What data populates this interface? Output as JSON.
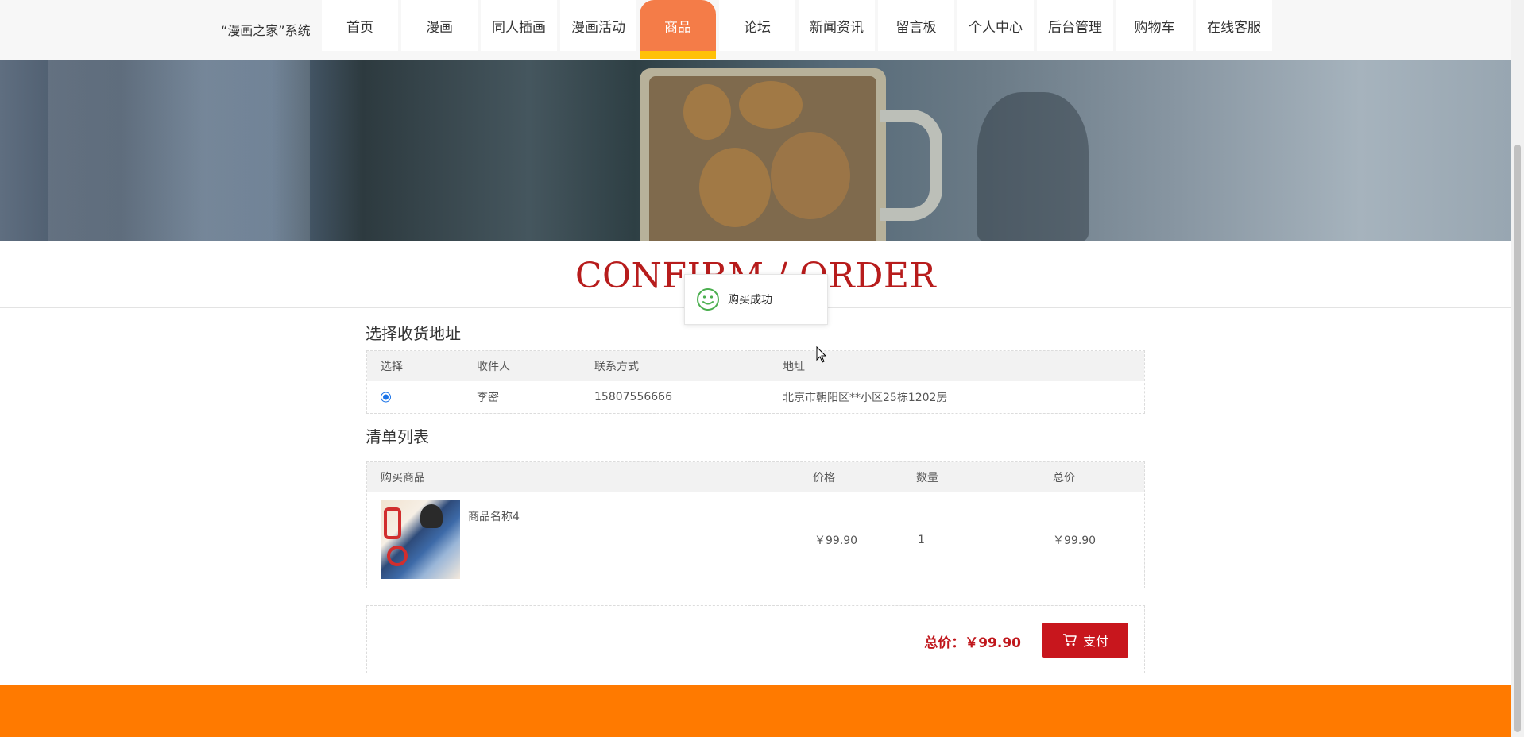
{
  "brand": "“漫画之家”系统",
  "nav": [
    {
      "label": "首页",
      "active": false
    },
    {
      "label": "漫画",
      "active": false
    },
    {
      "label": "同人插画",
      "active": false
    },
    {
      "label": "漫画活动",
      "active": false
    },
    {
      "label": "商品",
      "active": true
    },
    {
      "label": "论坛",
      "active": false
    },
    {
      "label": "新闻资讯",
      "active": false
    },
    {
      "label": "留言板",
      "active": false
    },
    {
      "label": "个人中心",
      "active": false
    },
    {
      "label": "后台管理",
      "active": false
    },
    {
      "label": "购物车",
      "active": false
    },
    {
      "label": "在线客服",
      "active": false
    }
  ],
  "page_title": "CONFIRM / ORDER",
  "toast": {
    "message": "购买成功",
    "icon": "smile-icon"
  },
  "address_section": {
    "title": "选择收货地址",
    "headers": {
      "select": "选择",
      "recipient": "收件人",
      "contact": "联系方式",
      "address": "地址"
    },
    "rows": [
      {
        "selected": true,
        "recipient": "李密",
        "contact": "15807556666",
        "address": "北京市朝阳区**小区25栋1202房"
      }
    ]
  },
  "items_section": {
    "title": "清单列表",
    "headers": {
      "product": "购买商品",
      "price": "价格",
      "qty": "数量",
      "total": "总价"
    },
    "rows": [
      {
        "name": "商品名称4",
        "price": "￥99.90",
        "qty": "1",
        "total": "￥99.90"
      }
    ]
  },
  "summary": {
    "total_label": "总价：",
    "total_value": "￥99.90",
    "pay_label": "支付"
  },
  "colors": {
    "accent": "#c8161d",
    "active_nav": "#f47c48",
    "active_underline": "#ffc107",
    "footer": "#ff7a00",
    "title": "#b71c1c"
  }
}
